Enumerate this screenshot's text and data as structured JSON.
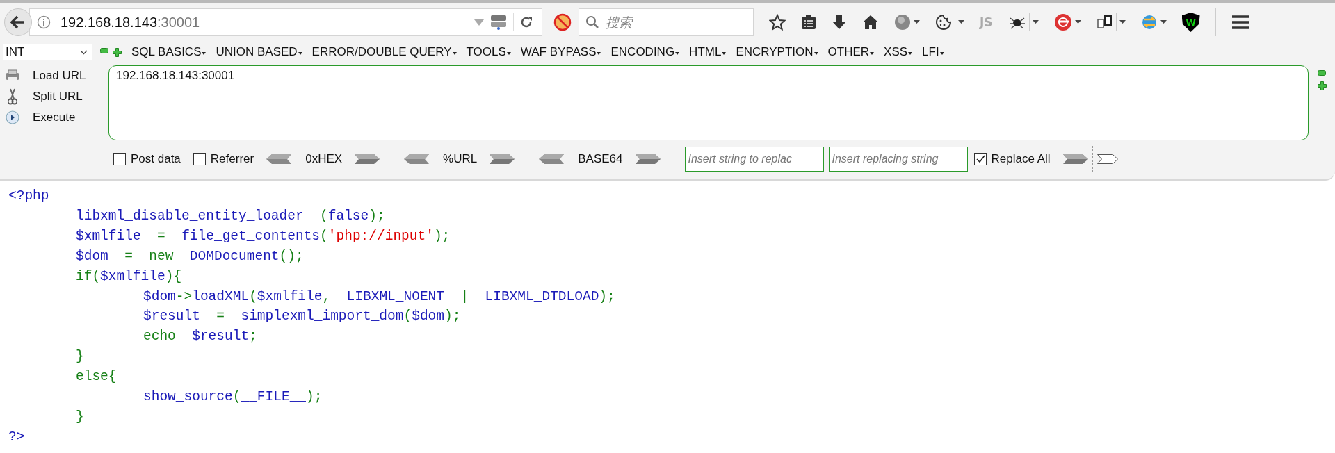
{
  "browser": {
    "url_host": "192.168.18.143",
    "url_port": ":30001",
    "search_placeholder": "搜索",
    "js_label": "JS",
    "shield_label": "W"
  },
  "hackbar": {
    "select_value": "INT",
    "menus": [
      "SQL BASICS",
      "UNION BASED",
      "ERROR/DOUBLE QUERY",
      "TOOLS",
      "WAF BYPASS",
      "ENCODING",
      "HTML",
      "ENCRYPTION",
      "OTHER",
      "XSS",
      "LFI"
    ],
    "actions": [
      {
        "kind": "load",
        "label": "Load URL"
      },
      {
        "kind": "split",
        "label": "Split URL"
      },
      {
        "kind": "execute",
        "label": "Execute"
      }
    ],
    "url_text": "192.168.18.143:30001",
    "options": [
      {
        "label": "Post data",
        "checked": false
      },
      {
        "label": "Referrer",
        "checked": false
      }
    ],
    "encoders": [
      "0xHEX",
      "%URL",
      "BASE64"
    ],
    "replace_placeholder": "Insert string to replac",
    "replacing_placeholder": "Insert replacing string",
    "replace_all": {
      "label": "Replace All",
      "checked": true
    }
  },
  "code": {
    "lines": [
      {
        "tokens": [
          {
            "kind": "default",
            "text": "<?php"
          }
        ],
        "children": [
          {
            "tokens": [
              {
                "kind": "default",
                "text": "libxml_disable_entity_loader  "
              },
              {
                "kind": "keyword",
                "text": "("
              },
              {
                "kind": "default",
                "text": "false"
              },
              {
                "kind": "keyword",
                "text": ");"
              }
            ]
          },
          {
            "tokens": [
              {
                "kind": "default",
                "text": "$xmlfile  "
              },
              {
                "kind": "keyword",
                "text": "=  "
              },
              {
                "kind": "default",
                "text": "file_get_contents"
              },
              {
                "kind": "keyword",
                "text": "("
              },
              {
                "kind": "string",
                "text": "'php://input'"
              },
              {
                "kind": "keyword",
                "text": ");"
              }
            ]
          },
          {
            "tokens": [
              {
                "kind": "default",
                "text": "$dom  "
              },
              {
                "kind": "keyword",
                "text": "=  new  "
              },
              {
                "kind": "default",
                "text": "DOMDocument"
              },
              {
                "kind": "keyword",
                "text": "();"
              }
            ]
          },
          {
            "tokens": [
              {
                "kind": "keyword",
                "text": "if("
              },
              {
                "kind": "default",
                "text": "$xmlfile"
              },
              {
                "kind": "keyword",
                "text": "){"
              }
            ],
            "children": [
              {
                "tokens": [
                  {
                    "kind": "default",
                    "text": "$dom"
                  },
                  {
                    "kind": "keyword",
                    "text": "->"
                  },
                  {
                    "kind": "default",
                    "text": "loadXML"
                  },
                  {
                    "kind": "keyword",
                    "text": "("
                  },
                  {
                    "kind": "default",
                    "text": "$xmlfile"
                  },
                  {
                    "kind": "keyword",
                    "text": ",  "
                  },
                  {
                    "kind": "default",
                    "text": "LIBXML_NOENT  "
                  },
                  {
                    "kind": "keyword",
                    "text": "|  "
                  },
                  {
                    "kind": "default",
                    "text": "LIBXML_DTDLOAD"
                  },
                  {
                    "kind": "keyword",
                    "text": ");"
                  }
                ]
              },
              {
                "tokens": [
                  {
                    "kind": "default",
                    "text": "$result  "
                  },
                  {
                    "kind": "keyword",
                    "text": "=  "
                  },
                  {
                    "kind": "default",
                    "text": "simplexml_import_dom"
                  },
                  {
                    "kind": "keyword",
                    "text": "("
                  },
                  {
                    "kind": "default",
                    "text": "$dom"
                  },
                  {
                    "kind": "keyword",
                    "text": ");"
                  }
                ]
              },
              {
                "tokens": [
                  {
                    "kind": "keyword",
                    "text": "echo  "
                  },
                  {
                    "kind": "default",
                    "text": "$result"
                  },
                  {
                    "kind": "keyword",
                    "text": ";"
                  }
                ]
              }
            ]
          },
          {
            "tokens": [
              {
                "kind": "keyword",
                "text": "}"
              }
            ]
          },
          {
            "tokens": [
              {
                "kind": "keyword",
                "text": "else{"
              }
            ],
            "children": [
              {
                "tokens": [
                  {
                    "kind": "default",
                    "text": "show_source"
                  },
                  {
                    "kind": "keyword",
                    "text": "("
                  },
                  {
                    "kind": "default",
                    "text": "__FILE__"
                  },
                  {
                    "kind": "keyword",
                    "text": ");"
                  }
                ]
              }
            ]
          },
          {
            "tokens": [
              {
                "kind": "keyword",
                "text": "}"
              }
            ]
          }
        ]
      },
      {
        "tokens": [
          {
            "kind": "default",
            "text": "?>"
          }
        ]
      }
    ]
  }
}
